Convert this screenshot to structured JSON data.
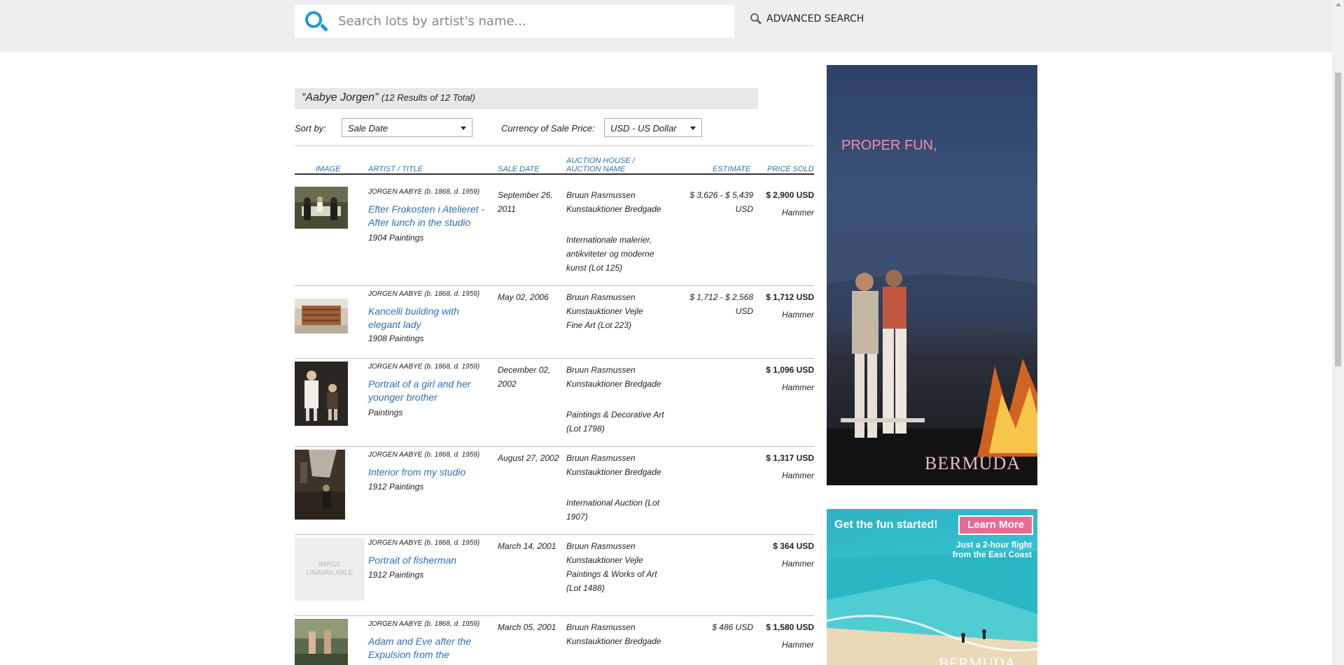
{
  "search": {
    "placeholder": "Search lots by artist's name...",
    "advanced_label": "ADVANCED SEARCH"
  },
  "results": {
    "query": "“Aabye Jorgen”",
    "count_text": "(12 Results of 12 Total)"
  },
  "sort": {
    "label": "Sort by:",
    "value": "Sale Date"
  },
  "currency": {
    "label": "Currency of Sale Price:",
    "value": "USD - US Dollar"
  },
  "columns": {
    "image": "IMAGE",
    "artist_title": "ARTIST / TITLE",
    "sale_date": "SALE DATE",
    "auction_house_1": "AUCTION HOUSE /",
    "auction_house_2": "AUCTION NAME",
    "estimate": "ESTIMATE",
    "price_sold": "PRICE SOLD"
  },
  "rows": [
    {
      "artist_name": "JORGEN AABYE",
      "artist_dates": "(b. 1868, d. 1959)",
      "title": "Efter Frokosten i Atelieret - After lunch in the studio",
      "medium": "1904 Paintings",
      "date": "September 26, 2011",
      "house": "Bruun Rasmussen Kunstauktioner Bredgade",
      "sale": "Internationale malerier, antikviteter og moderne kunst (Lot 125)",
      "estimate": "$ 3,626 - $ 5,439 USD",
      "price": "$ 2,900 USD",
      "hammer": "Hammer"
    },
    {
      "artist_name": "JORGEN AABYE",
      "artist_dates": "(b. 1868, d. 1959)",
      "title": "Kancelli building with elegant lady",
      "medium": "1908 Paintings",
      "date": "May 02, 2006",
      "house": "Bruun Rasmussen Kunstauktioner Vejle",
      "sale": "Fine Art (Lot 223)",
      "estimate": "$ 1,712 - $ 2,568 USD",
      "price": "$ 1,712 USD",
      "hammer": "Hammer"
    },
    {
      "artist_name": "JORGEN AABYE",
      "artist_dates": "(b. 1868, d. 1959)",
      "title": "Portrait of a girl and her younger brother",
      "medium": "Paintings",
      "date": "December 02, 2002",
      "house": "Bruun Rasmussen Kunstauktioner Bredgade",
      "sale": "Paintings & Decorative Art (Lot 1798)",
      "estimate": "",
      "price": "$ 1,096 USD",
      "hammer": "Hammer"
    },
    {
      "artist_name": "JORGEN AABYE",
      "artist_dates": "(b. 1868, d. 1959)",
      "title": "Interior from my studio",
      "medium": "1912 Paintings",
      "date": "August 27, 2002",
      "house": "Bruun Rasmussen Kunstauktioner Bredgade",
      "sale": "International Auction (Lot 1907)",
      "estimate": "",
      "price": "$ 1,317 USD",
      "hammer": "Hammer"
    },
    {
      "artist_name": "JORGEN AABYE",
      "artist_dates": "(b. 1868, d. 1959)",
      "title": "Portrait of fisherman",
      "medium": "1912 Paintings",
      "date": "March 14, 2001",
      "house": "Bruun Rasmussen Kunstauktioner Vejle",
      "sale": "Paintings & Works of Art (Lot 1488)",
      "estimate": "",
      "price": "$ 364 USD",
      "hammer": "Hammer",
      "image_unavailable": "IMAGE UNAVAILABLE"
    },
    {
      "artist_name": "JORGEN AABYE",
      "artist_dates": "(b. 1868, d. 1959)",
      "title": "Adam and Eve after the Expulsion from the",
      "medium": "",
      "date": "March 05, 2001",
      "house": "Bruun Rasmussen Kunstauktioner Bredgade",
      "sale": "",
      "estimate": "$ 486 USD",
      "price": "$ 1,580 USD",
      "hammer": "Hammer"
    }
  ],
  "ad1": {
    "headline": "PROPER FUN,",
    "brand": "BERMUDA"
  },
  "ad2": {
    "cta": "Get the fun started!",
    "button": "Learn More",
    "sub1": "Just a 2-hour flight",
    "sub2": "from the East Coast",
    "brand": "BERMUDA"
  },
  "colors": {
    "accent": "#1a9ad6",
    "link": "#2e6fb7",
    "brand_pink": "#e86b93"
  }
}
